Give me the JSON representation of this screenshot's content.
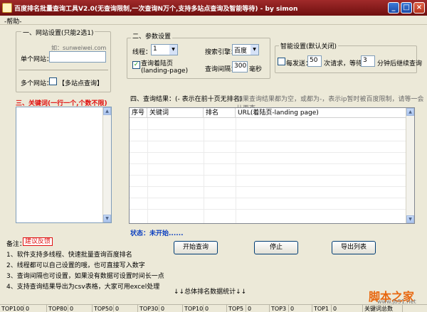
{
  "window": {
    "title": "百度排名批量查询工具V2.0(无查询限制,一次查询N万个,支持多站点查询及智能等待) - by simon",
    "menu": "帮助"
  },
  "site_settings": {
    "group_title": "一、网站设置(只能2选1)",
    "example": "如：sunweiwei.com",
    "single_label": "单个网站：",
    "single_value": "",
    "multi_label": "多个网站：",
    "multi_checkbox": "【多站点查询】"
  },
  "keywords": {
    "title": "三、关键词(一行一个,个数不限)",
    "value": ""
  },
  "params": {
    "group_title": "二、参数设置",
    "threads_label": "线程：",
    "threads_value": "1",
    "engine_label": "搜索引擎：",
    "engine_value": "百度",
    "landing_label": "查询着陆页\n(landing-page)",
    "landing_checked": true,
    "interval_label": "查询间隔：",
    "interval_value": "300",
    "interval_unit": "毫秒"
  },
  "smart": {
    "group_title": "智能设置(默认关闭)",
    "send_label": "每发送：",
    "send_value": "50",
    "req_label": "次请求，等待：",
    "wait_value": "3",
    "wait_unit": "分钟后继续查询",
    "checked": false
  },
  "results": {
    "title": "四、查询结果：(- 表示在前十页无排名)",
    "hint": "如果查询结果都为空，或都为-，表示ip暂时被百度限制，请等一会儿再查",
    "columns": [
      "序号",
      "关键词",
      "排名",
      "URL(着陆页-landing page)"
    ],
    "status_label": "状态：",
    "status_value": "未开始......"
  },
  "buttons": {
    "start": "开始查询",
    "stop": "停止",
    "export": "导出列表"
  },
  "notes": {
    "label": "备注：",
    "feedback": "建议反馈",
    "items": [
      "1、软件支持多线程、快速批量查询百度排名",
      "2、线程都可以自己设置的哦，也可直接写入数字",
      "3、查询间隔也可设置，如果没有数据可设置时间长一点",
      "4、支持查询结果导出为csv表格，大家可用excel处理"
    ]
  },
  "summary_label": "↓↓总体排名数据统计↓↓",
  "stats": [
    {
      "label": "TOP100",
      "value": "0"
    },
    {
      "label": "TOP80",
      "value": "0"
    },
    {
      "label": "TOP50",
      "value": "0"
    },
    {
      "label": "TOP30",
      "value": "0"
    },
    {
      "label": "TOP10",
      "value": "0"
    },
    {
      "label": "TOP5",
      "value": "0"
    },
    {
      "label": "TOP3",
      "value": "0"
    },
    {
      "label": "TOP1",
      "value": "0"
    },
    {
      "label": "关键词总数",
      "value": ""
    }
  ],
  "watermark": {
    "text": "脚本之家",
    "url": "www.jb51.net"
  },
  "colors": {
    "titlebar": "#8a1c1c",
    "accent_red": "#e01010",
    "status_blue": "#0b3fc0",
    "watermark": "#e86810"
  }
}
